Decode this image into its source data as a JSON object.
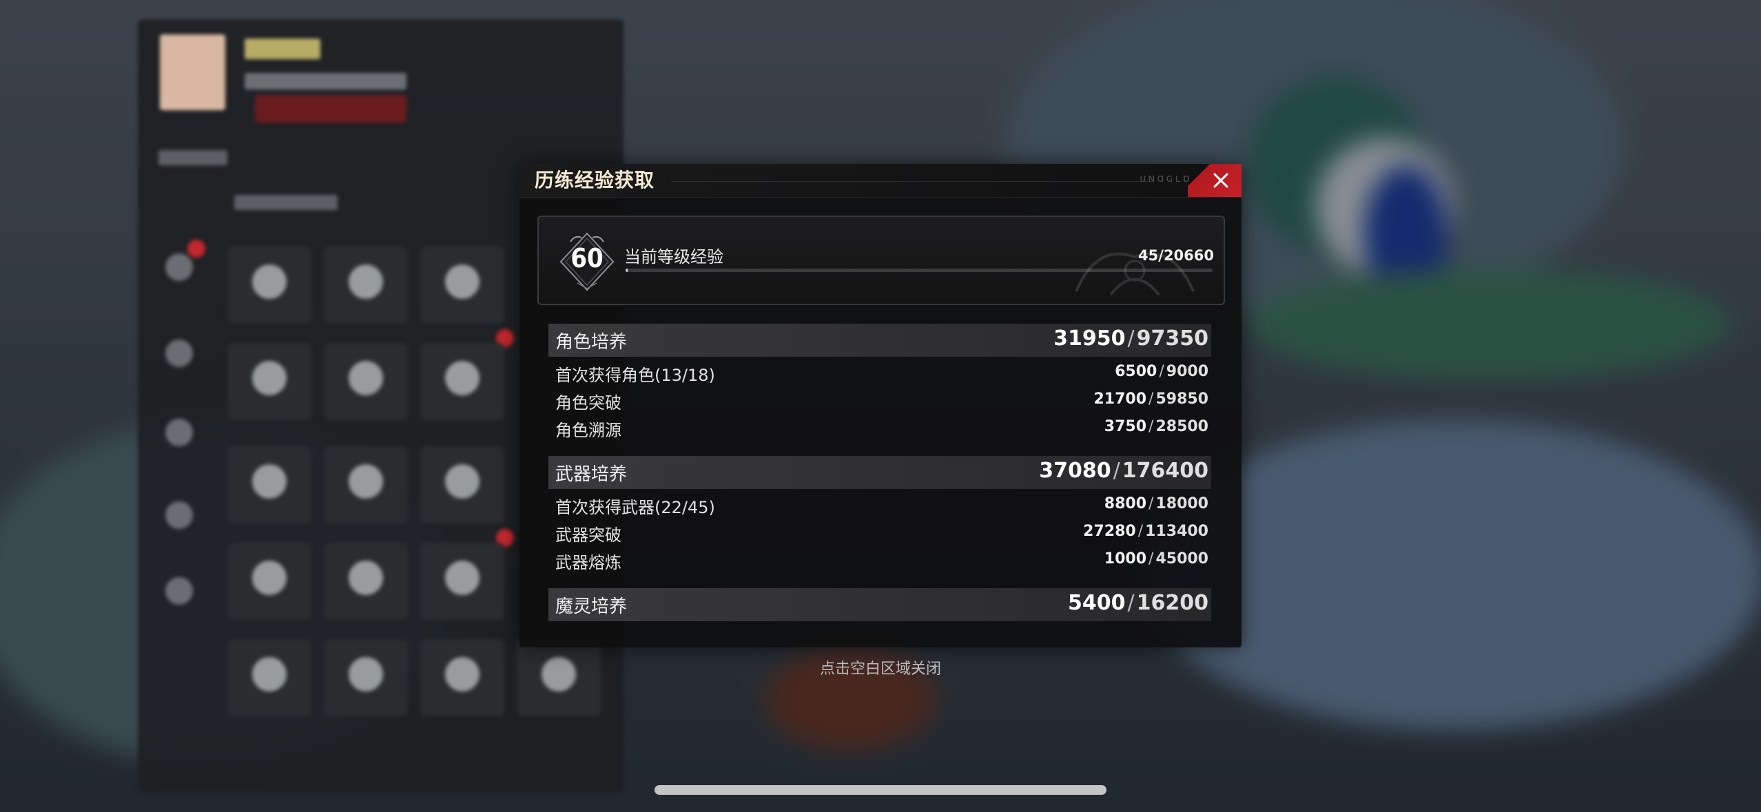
{
  "dialog": {
    "title": "历练经验获取",
    "title_decoration": "ᴜɴɑɢʟɒ",
    "close_icon": "close-x-icon"
  },
  "level": {
    "number": "60",
    "label": "当前等级经验",
    "value": "45/20660",
    "progress_fraction": 0.0022
  },
  "sections": [
    {
      "label": "角色培养",
      "current": "31950",
      "max": "97350",
      "rows": [
        {
          "label": "首次获得角色(13/18)",
          "current": "6500",
          "max": "9000"
        },
        {
          "label": "角色突破",
          "current": "21700",
          "max": "59850"
        },
        {
          "label": "角色溯源",
          "current": "3750",
          "max": "28500"
        }
      ]
    },
    {
      "label": "武器培养",
      "current": "37080",
      "max": "176400",
      "rows": [
        {
          "label": "首次获得武器(22/45)",
          "current": "8800",
          "max": "18000"
        },
        {
          "label": "武器突破",
          "current": "27280",
          "max": "113400"
        },
        {
          "label": "武器熔炼",
          "current": "1000",
          "max": "45000"
        }
      ]
    },
    {
      "label": "魔灵培养",
      "current": "5400",
      "max": "16200",
      "rows": []
    }
  ],
  "hint": "点击空白区域关闭",
  "colors": {
    "accent_red": "#c62228",
    "title_text": "#f3ead2",
    "dialog_bg": "#0e0e0f"
  }
}
